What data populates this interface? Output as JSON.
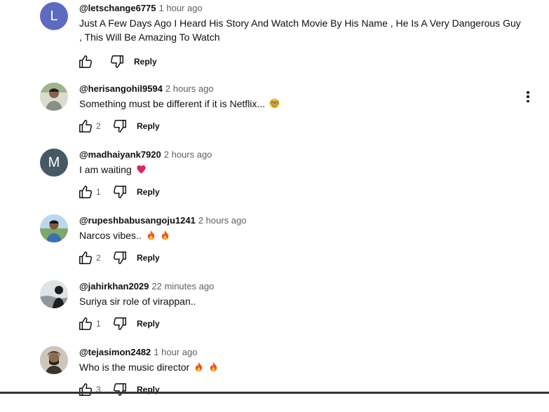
{
  "comments": [
    {
      "handle": "@letschange6775",
      "time": "1 hour ago",
      "text": "Just A Few Days Ago I Heard His Story And Watch Movie By His Name , He Is A Very Dangerous Guy , This Will Be Amazing To Watch",
      "likes": "",
      "avatar_letter": "L",
      "avatar_color": "#5c6bc0",
      "reply": "Reply"
    },
    {
      "handle": "@herisangohil9594",
      "time": "2 hours ago",
      "text": "Something must be different if it is Netflix...",
      "emoji": "nerd-face",
      "likes": "2",
      "reply": "Reply"
    },
    {
      "handle": "@madhaiyank7920",
      "time": "2 hours ago",
      "text": "I am waiting",
      "emoji": "heart",
      "likes": "1",
      "avatar_letter": "M",
      "avatar_color": "#455a64",
      "reply": "Reply"
    },
    {
      "handle": "@rupeshbabusangoju1241",
      "time": "2 hours ago",
      "text": "Narcos vibes..",
      "emoji": "fire fire",
      "likes": "2",
      "reply": "Reply"
    },
    {
      "handle": "@jahirkhan2029",
      "time": "22 minutes ago",
      "text": "Suriya sir role of virappan..",
      "likes": "1",
      "reply": "Reply"
    },
    {
      "handle": "@tejasimon2482",
      "time": "1 hour ago",
      "text": "Who is the music director",
      "emoji": "fire fire",
      "likes": "3",
      "reply": "Reply"
    }
  ],
  "icons": {
    "like": "thumbs-up-icon",
    "dislike": "thumbs-down-icon",
    "more": "more-vertical-icon"
  }
}
